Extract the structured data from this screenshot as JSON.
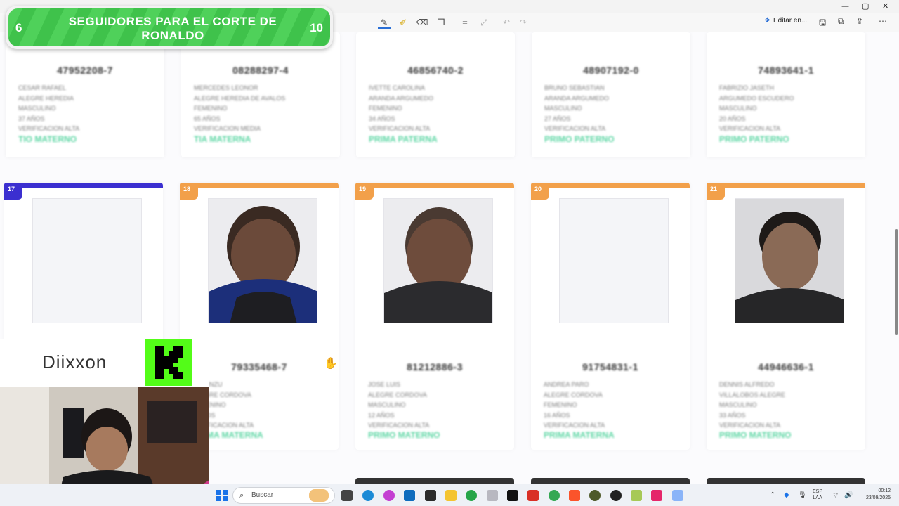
{
  "window": {
    "minimize": "—",
    "maximize": "▢",
    "close": "✕"
  },
  "toolbar": {
    "edit_label": "Editar en..."
  },
  "row_top": [
    {
      "dni": "47952208-7",
      "info": [
        "CESAR RAFAEL",
        "ALEGRE HEREDIA",
        "MASCULINO",
        "37 AÑOS",
        "VERIFICACION ALTA"
      ],
      "relation": "TIO MATERNO"
    },
    {
      "dni": "08288297-4",
      "info": [
        "MERCEDES LEONOR",
        "ALEGRE HEREDIA DE AVALOS",
        "FEMENINO",
        "65 AÑOS",
        "VERIFICACION MEDIA"
      ],
      "relation": "TIA MATERNA"
    },
    {
      "dni": "46856740-2",
      "info": [
        "IVETTE CAROLINA",
        "ARANDA ARGUMEDO",
        "FEMENINO",
        "34 AÑOS",
        "VERIFICACION ALTA"
      ],
      "relation": "PRIMA PATERNA"
    },
    {
      "dni": "48907192-0",
      "info": [
        "BRUNO SEBASTIAN",
        "ARANDA ARGUMEDO",
        "MASCULINO",
        "27 AÑOS",
        "VERIFICACION ALTA"
      ],
      "relation": "PRIMO PATERNO"
    },
    {
      "dni": "74893641-1",
      "info": [
        "FABRIZIO JASETH",
        "ARGUMEDO ESCUDERO",
        "MASCULINO",
        "20 AÑOS",
        "VERIFICACION ALTA"
      ],
      "relation": "PRIMO PATERNO"
    }
  ],
  "row_bottom": [
    {
      "num": "17",
      "accent": "#3b2fd0",
      "dni": "",
      "info": [],
      "relation": ""
    },
    {
      "num": "18",
      "accent": "#f2a04a",
      "dni": "79335468-7",
      "info": [
        "LIA KINZU",
        "ALEGRE CORDOVA",
        "FEMENINO",
        "5 AÑOS",
        "VERIFICACION ALTA"
      ],
      "relation": "PRIMA MATERNA"
    },
    {
      "num": "19",
      "accent": "#f2a04a",
      "dni": "81212886-3",
      "info": [
        "JOSE LUIS",
        "ALEGRE CORDOVA",
        "MASCULINO",
        "12 AÑOS",
        "VERIFICACION ALTA"
      ],
      "relation": "PRIMO MATERNO"
    },
    {
      "num": "20",
      "accent": "#f2a04a",
      "dni": "91754831-1",
      "info": [
        "ANDREA PARO",
        "ALEGRE CORDOVA",
        "FEMENINO",
        "16 AÑOS",
        "VERIFICACION ALTA"
      ],
      "relation": "PRIMA MATERNA"
    },
    {
      "num": "21",
      "accent": "#f2a04a",
      "dni": "44946636-1",
      "info": [
        "DENNIS ALFREDO",
        "VILLALOBOS ALEGRE",
        "MASCULINO",
        "33 AÑOS",
        "VERIFICACION ALTA"
      ],
      "relation": "PRIMO MATERNO"
    }
  ],
  "goal": {
    "current": "6",
    "title": "SEGUIDORES PARA EL CORTE DE RONALDO",
    "max": "10",
    "progress": 0.6
  },
  "brand": {
    "name": "Diixxon",
    "logo_letter": "K",
    "logo_color": "#53fc18"
  },
  "taskbar": {
    "search_placeholder": "Buscar",
    "lang_top": "ESP",
    "lang_bottom": "LAA",
    "time": "00:12",
    "date": "23/09/2025"
  }
}
